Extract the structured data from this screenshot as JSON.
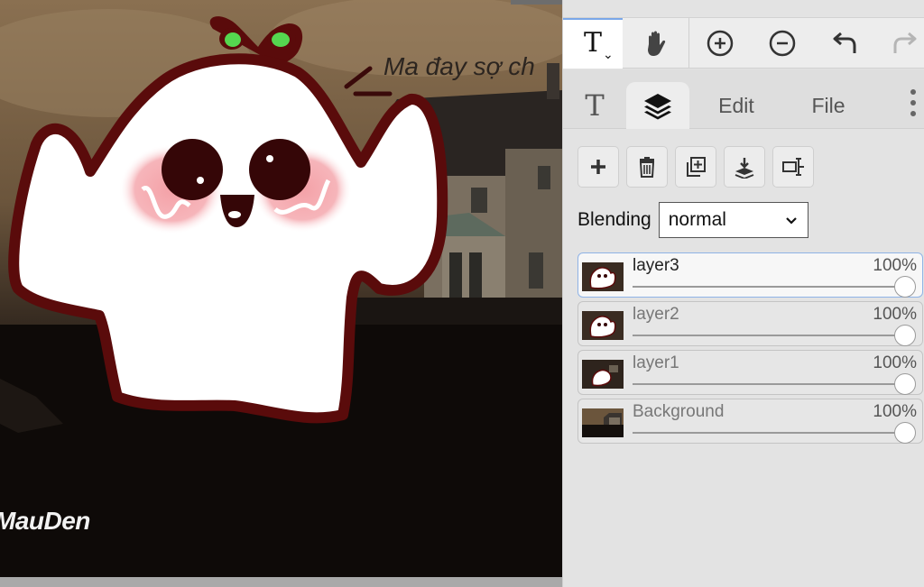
{
  "canvas": {
    "caption": "Ma đay sợ ch",
    "watermark": "MauDen"
  },
  "toolbar": {
    "tools": [
      {
        "name": "text-tool",
        "icon": "text-icon",
        "glyph": "T",
        "active": true
      },
      {
        "name": "hand-tool",
        "icon": "hand-icon"
      },
      {
        "name": "zoom-in",
        "icon": "zoom-in-icon"
      },
      {
        "name": "zoom-out",
        "icon": "zoom-out-icon"
      },
      {
        "name": "undo",
        "icon": "undo-icon"
      },
      {
        "name": "redo",
        "icon": "redo-icon",
        "disabled": true
      }
    ]
  },
  "tabs": {
    "text_tab_glyph": "T",
    "layers_tab_icon": "layers-icon",
    "edit_label": "Edit",
    "file_label": "File",
    "more_icon": "more-vertical-icon",
    "active": "layers"
  },
  "layer_actions": [
    "add-layer-icon",
    "delete-layer-icon",
    "duplicate-layer-icon",
    "merge-down-icon",
    "rename-layer-icon"
  ],
  "blending": {
    "label": "Blending",
    "value": "normal"
  },
  "layers": [
    {
      "name": "layer3",
      "opacity": "100%",
      "active": true
    },
    {
      "name": "layer2",
      "opacity": "100%"
    },
    {
      "name": "layer1",
      "opacity": "100%"
    },
    {
      "name": "Background",
      "opacity": "100%"
    }
  ],
  "colors": {
    "accent": "#7aa7e8",
    "ghost_outline": "#5a0b0b",
    "ghost_sprout": "#55d64f",
    "sky": "#8a7051"
  }
}
